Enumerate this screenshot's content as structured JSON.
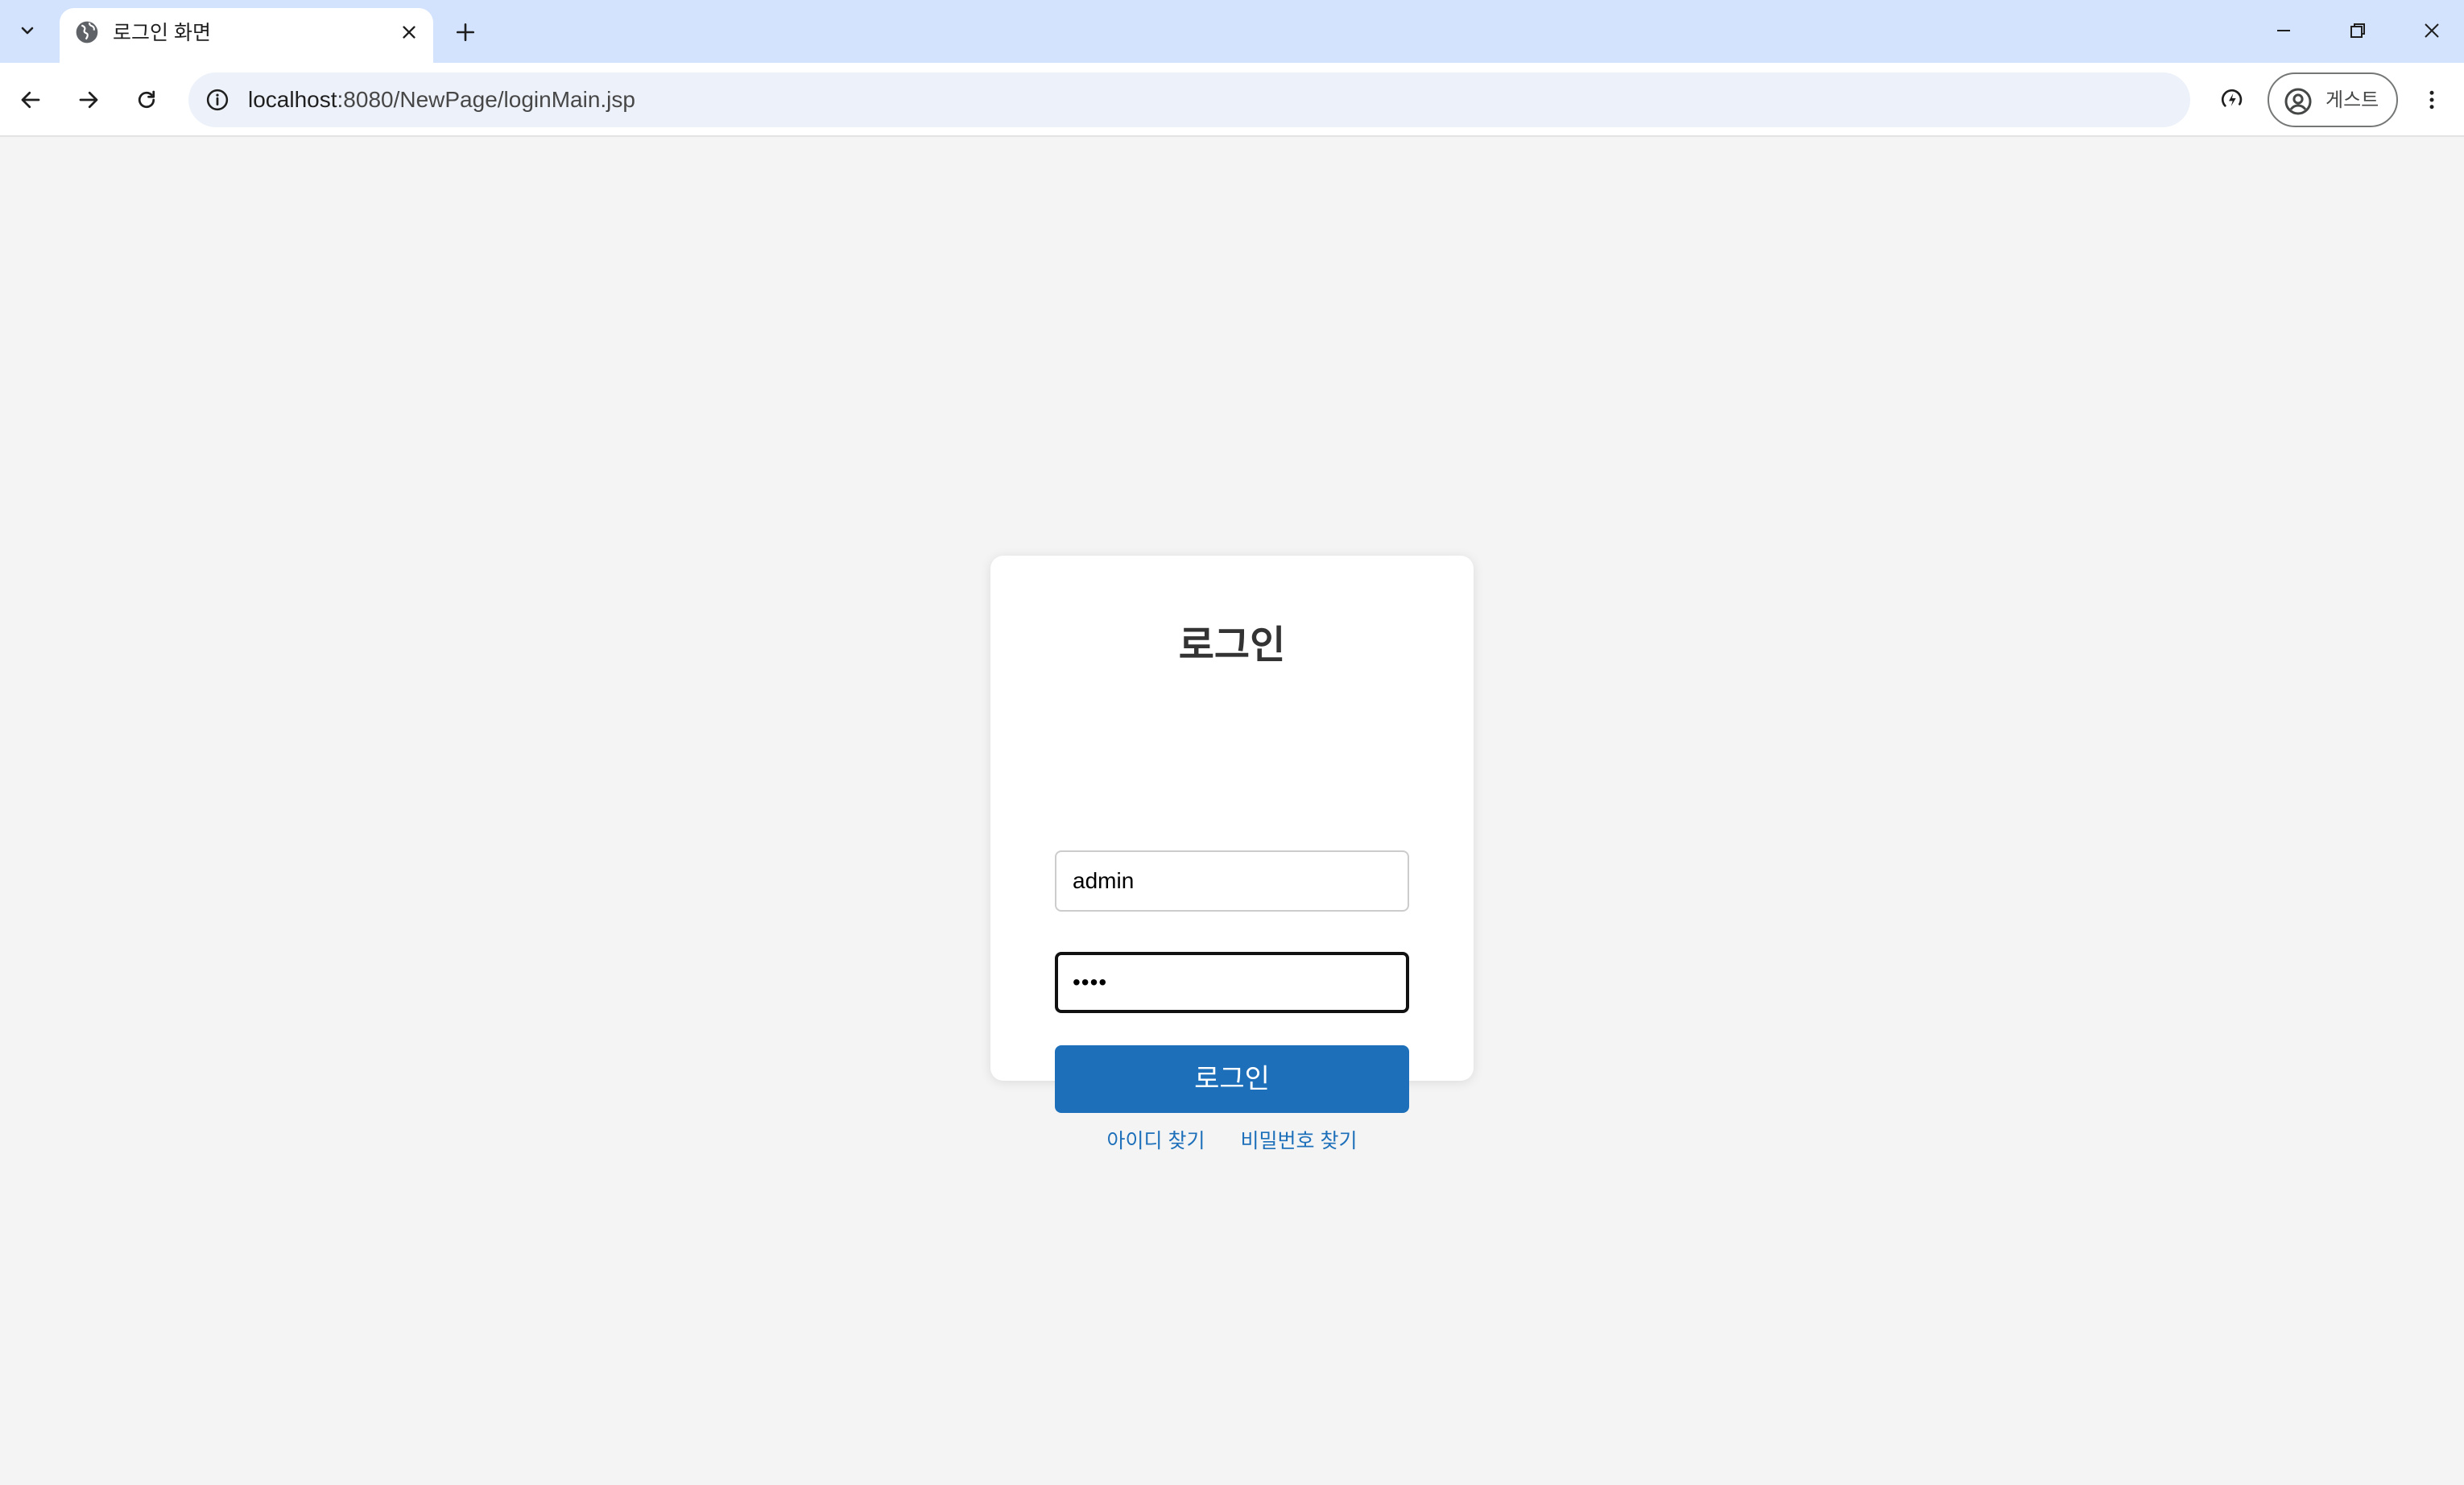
{
  "browser": {
    "tab": {
      "title": "로그인 화면",
      "favicon": "globe-icon"
    },
    "address": {
      "host": "localhost",
      "path": ":8080/NewPage/loginMain.jsp"
    },
    "profile_label": "게스트",
    "icons": {
      "tab_search": "chevron-down-icon",
      "tab_close": "close-icon",
      "new_tab": "plus-icon",
      "minimize": "minimize-icon",
      "restore": "restore-icon",
      "close_window": "close-icon",
      "back": "back-arrow-icon",
      "forward": "forward-arrow-icon",
      "reload": "reload-icon",
      "site_info": "info-icon",
      "performance": "performance-icon",
      "profile": "profile-icon",
      "menu": "kebab-menu-icon"
    },
    "colors": {
      "tabstrip": "#d3e3fd",
      "omnibox": "#edf2fa"
    }
  },
  "login": {
    "title": "로그인",
    "id_value": "admin",
    "password_mask": "••••",
    "submit_label": "로그인",
    "find_id_label": "아이디 찾기",
    "find_password_label": "비밀번호 찾기",
    "colors": {
      "primary": "#1d6fba",
      "background": "#f4f4f4",
      "card": "#ffffff"
    }
  }
}
